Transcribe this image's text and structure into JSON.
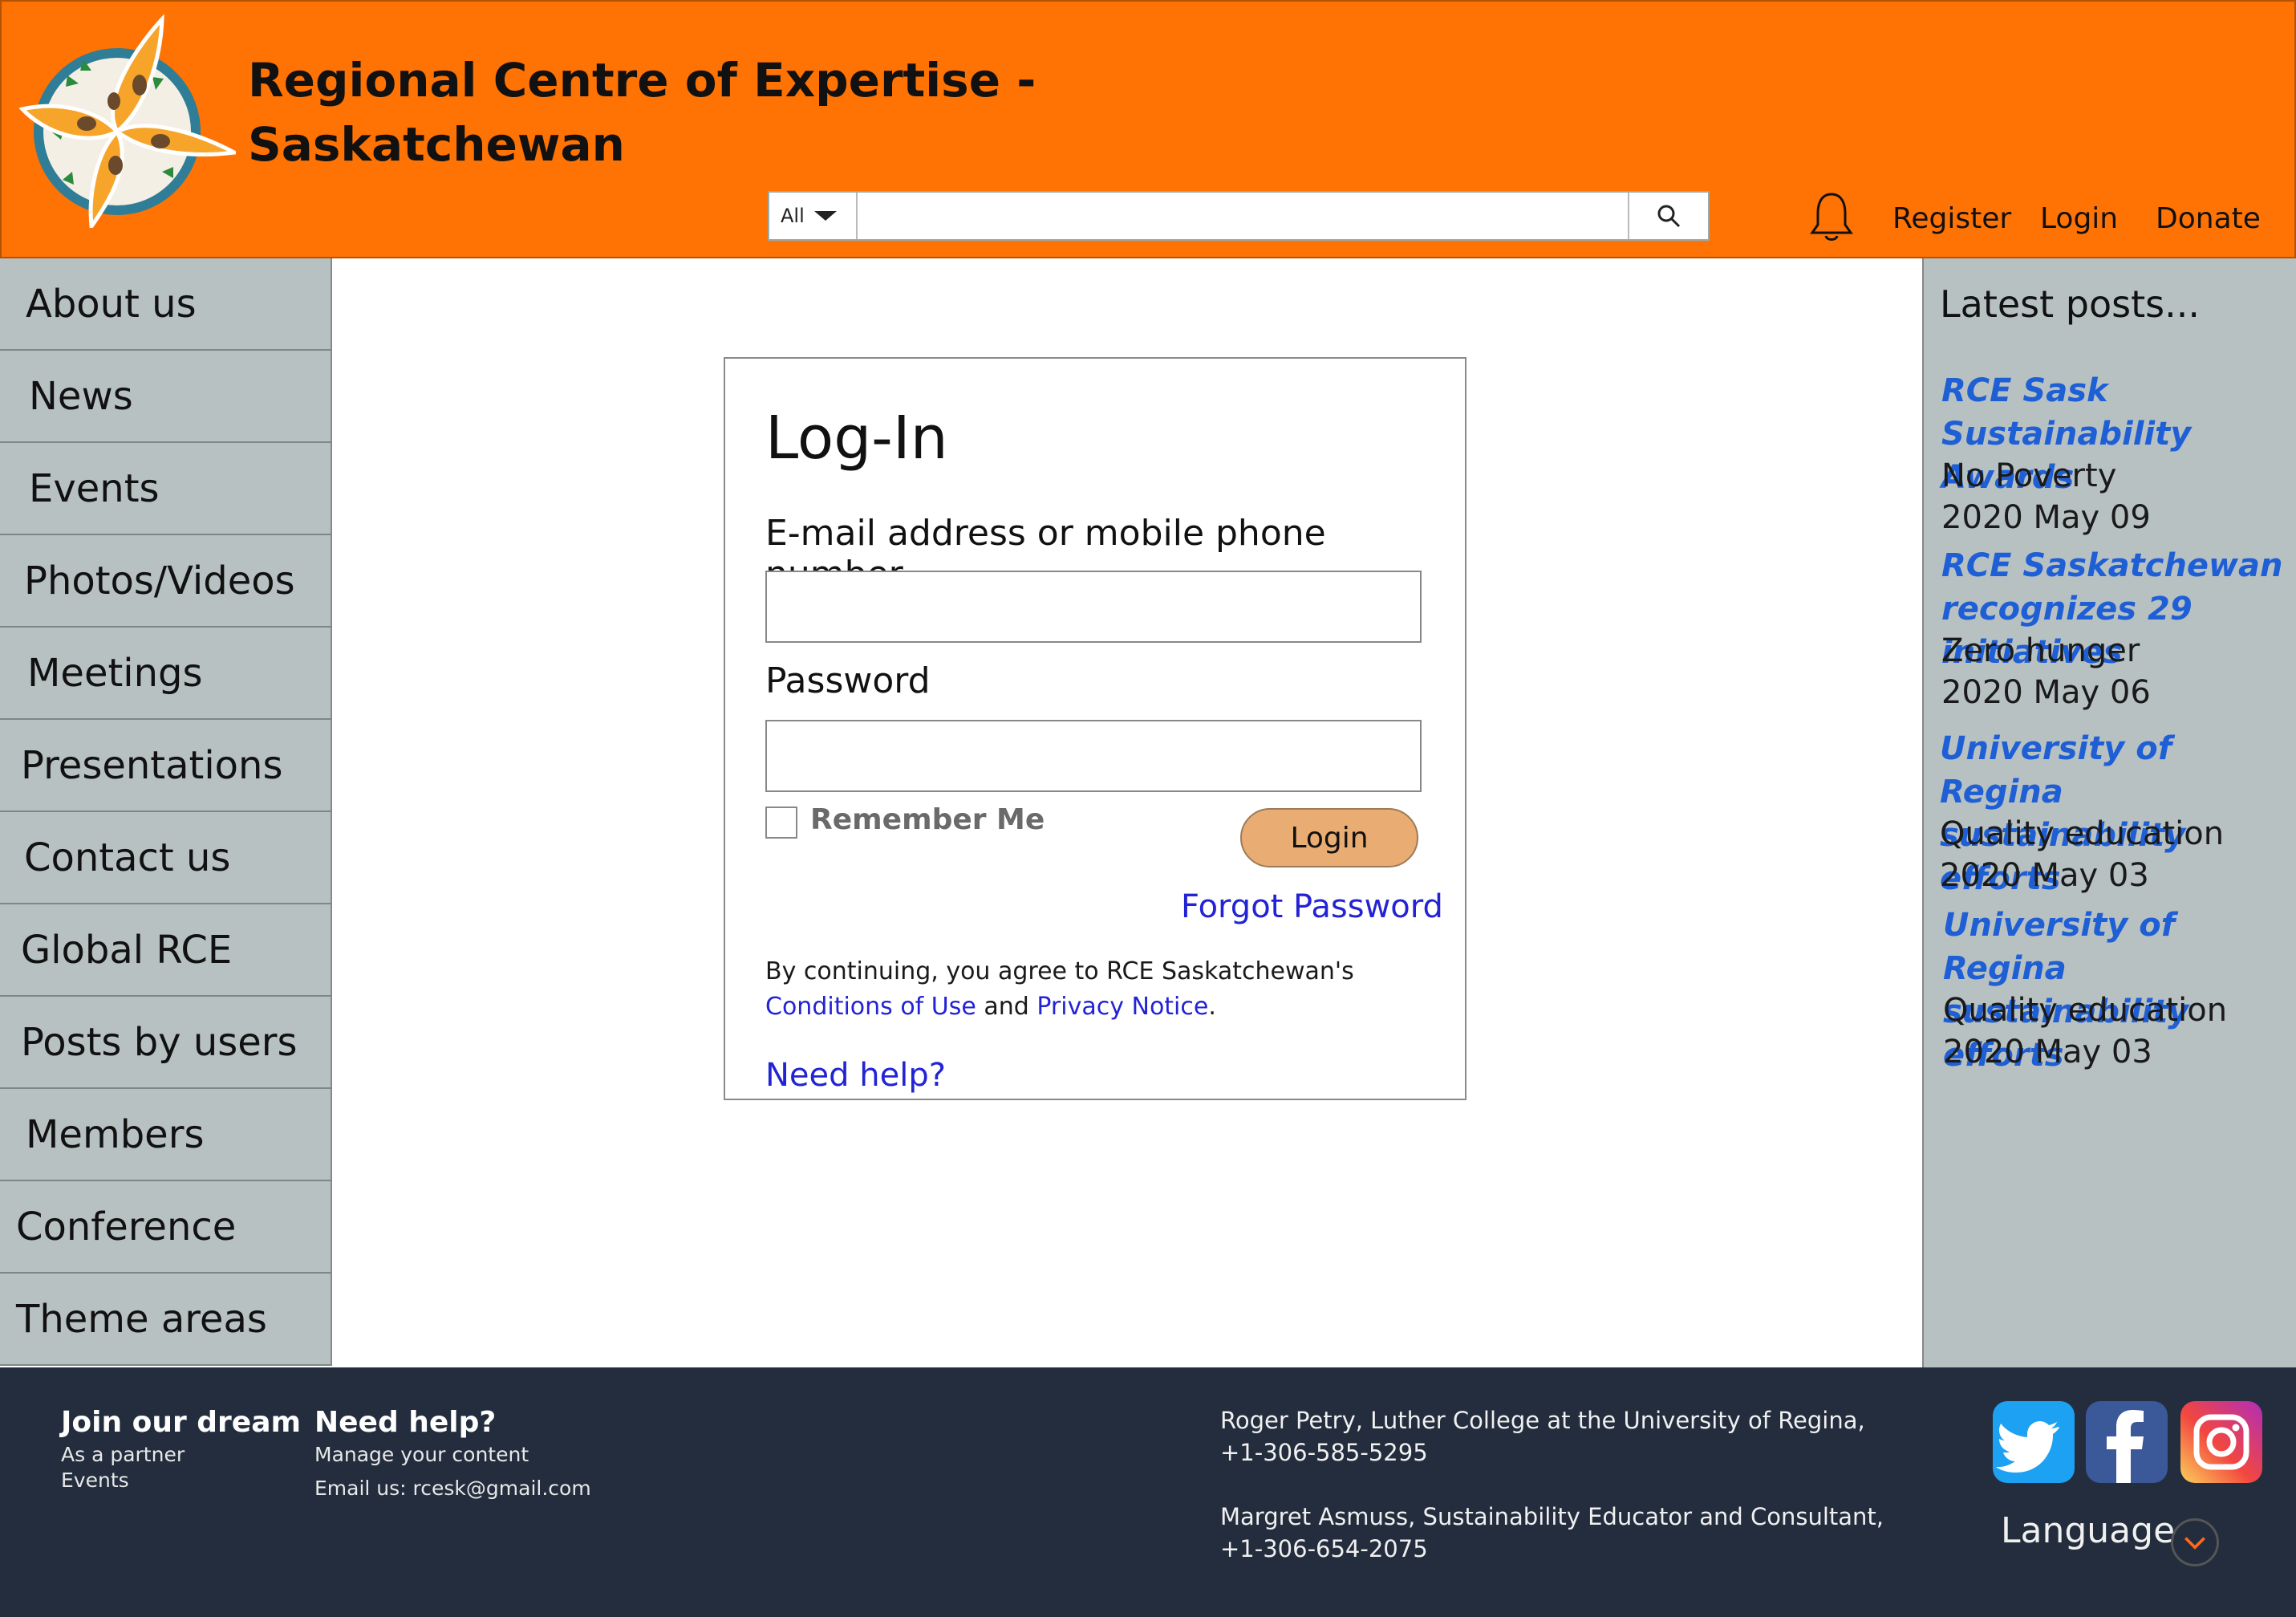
{
  "header": {
    "site_title_line1": "Regional Centre of Expertise -",
    "site_title_line2": "Saskatchewan",
    "search_scope": "All",
    "search_placeholder": "",
    "links": {
      "register": "Register",
      "login": "Login",
      "donate": "Donate"
    },
    "icons": {
      "bell": "bell-icon",
      "search": "search-icon"
    }
  },
  "left_nav": {
    "items": [
      {
        "label": "About us"
      },
      {
        "label": "News"
      },
      {
        "label": "Events"
      },
      {
        "label": "Photos/Videos"
      },
      {
        "label": "Meetings"
      },
      {
        "label": "Presentations"
      },
      {
        "label": "Contact us"
      },
      {
        "label": "Global RCE"
      },
      {
        "label": "Posts by users"
      },
      {
        "label": "Members"
      },
      {
        "label": "Conference"
      },
      {
        "label": "Theme areas"
      }
    ]
  },
  "login": {
    "heading": "Log-In",
    "email_label": "E-mail address or mobile phone number",
    "email_value": "",
    "password_label": "Password",
    "password_value": "",
    "remember_label": "Remember Me",
    "remember_checked": false,
    "login_button": "Login",
    "forgot_link": "Forgot Password",
    "agree_prefix": "By continuing, you agree to RCE Saskatchewan's ",
    "conditions_link": "Conditions of Use",
    "agree_and": " and ",
    "privacy_link": "Privacy Notice",
    "agree_suffix": ".",
    "help_link": "Need help?"
  },
  "latest_posts": {
    "title": "Latest posts...",
    "posts": [
      {
        "title_line1": "RCE Sask Sustainability",
        "title_line2": "Awards",
        "category": "No Poverty",
        "date": "2020 May 09"
      },
      {
        "title_line1": "RCE Saskatchewan",
        "title_line2": "recognizes 29 initiatives",
        "category": "Zero hunger",
        "date": "2020 May 06"
      },
      {
        "title_line1": "University of Regina",
        "title_line2": "sustainability efforts",
        "category": "Quality education",
        "date": "2020 May 03"
      },
      {
        "title_line1": "University of Regina",
        "title_line2": "sustainability efforts",
        "category": "Quality education",
        "date": "2020 May 03"
      }
    ]
  },
  "footer": {
    "join": {
      "heading": "Join our dream",
      "line1": "As a partner",
      "line2": "Events"
    },
    "help": {
      "heading": "Need help?",
      "line1": "Manage your content",
      "line2": "Email us: rcesk@gmail.com"
    },
    "contact1": {
      "line1": "Roger Petry, Luther College at the University of Regina,",
      "line2": "+1-306-585-5295"
    },
    "contact2": {
      "line1": "Margret Asmuss, Sustainability Educator and Consultant,",
      "line2": "+1-306-654-2075"
    },
    "language_label": "Language",
    "social": [
      "twitter-icon",
      "facebook-icon",
      "instagram-icon"
    ]
  },
  "colors": {
    "header_bg": "#ff7204",
    "sidebar_bg": "#b8c1c2",
    "footer_bg": "#232d3d",
    "link_blue": "#2323d6",
    "post_blue": "#1f5fd6",
    "login_button": "#e9ac72"
  }
}
